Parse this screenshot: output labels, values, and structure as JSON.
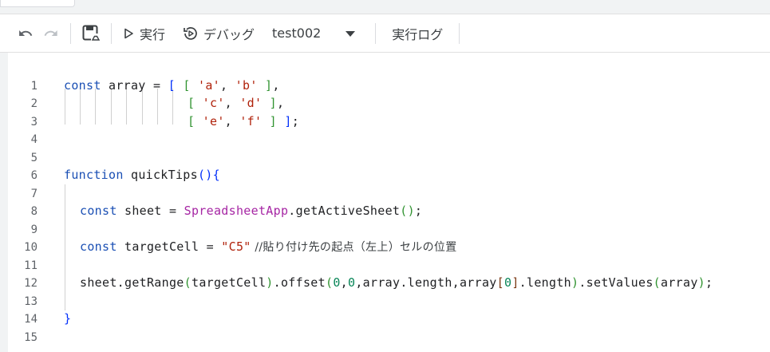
{
  "toolbar": {
    "undo_icon": "undo-icon",
    "redo_icon": "redo-icon",
    "save_icon": "save-drive-icon",
    "run_label": "実行",
    "debug_label": "デバッグ",
    "function_name": "test002",
    "log_label": "実行ログ"
  },
  "colors": {
    "keyword": "#1a4fb4",
    "string": "#b0220b",
    "number": "#098658",
    "class": "#a626a4"
  },
  "editor": {
    "line_numbers": [
      "1",
      "2",
      "3",
      "4",
      "5",
      "6",
      "7",
      "8",
      "9",
      "10",
      "11",
      "12",
      "13",
      "14",
      "15"
    ],
    "code": {
      "l1_kw": "const",
      "l1_a": " array = ",
      "l1_b": "[ ",
      "l1_c": "[ ",
      "l1_s1": "'a'",
      "l1_d": ", ",
      "l1_s2": "'b'",
      "l1_e": " ]",
      "l1_f": ",",
      "l2_a": "[ ",
      "l2_s1": "'c'",
      "l2_b": ", ",
      "l2_s2": "'d'",
      "l2_c": " ]",
      "l2_d": ",",
      "l3_a": "[ ",
      "l3_s1": "'e'",
      "l3_b": ", ",
      "l3_s2": "'f'",
      "l3_c": " ]",
      "l3_d": " ]",
      "l3_e": ";",
      "l6_kw": "function",
      "l6_a": " quickTips",
      "l6_b": "()",
      "l6_c": "{",
      "l8_kw": "const",
      "l8_a": " sheet = ",
      "l8_cls": "SpreadsheetApp",
      "l8_b": ".getActiveSheet",
      "l8_c": "()",
      "l8_d": ";",
      "l10_kw": "const",
      "l10_a": " targetCell = ",
      "l10_str": "\"C5\"",
      "l10_cmt": " //貼り付け先の起点（左上）セルの位置",
      "l12_a": "sheet.getRange",
      "l12_b": "(",
      "l12_c": "targetCell",
      "l12_d": ")",
      "l12_e": ".offset",
      "l12_f": "(",
      "l12_n1": "0",
      "l12_g": ",",
      "l12_n2": "0",
      "l12_h": ",array.length,array",
      "l12_i": "[",
      "l12_n3": "0",
      "l12_j": "]",
      "l12_k": ".length",
      "l12_l": ")",
      "l12_m": ".setValues",
      "l12_n": "(",
      "l12_o": "array",
      "l12_p": ")",
      "l12_q": ";",
      "l14_a": "}"
    }
  }
}
